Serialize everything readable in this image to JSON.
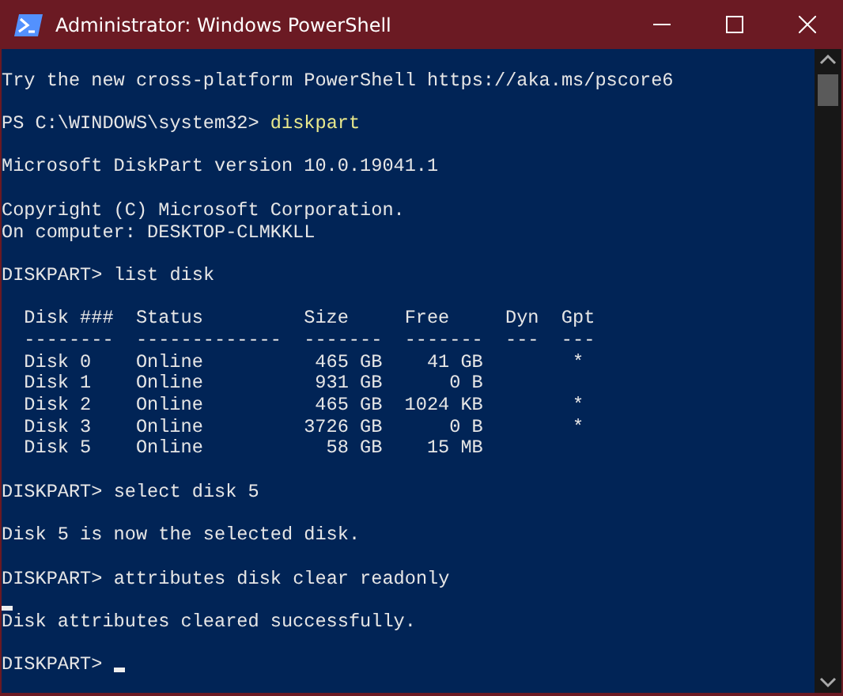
{
  "window": {
    "title": "Administrator: Windows PowerShell"
  },
  "lines": [
    {
      "kind": "blank"
    },
    {
      "kind": "text",
      "text": "Try the new cross-platform PowerShell https://aka.ms/pscore6"
    },
    {
      "kind": "blank"
    },
    {
      "kind": "prompt",
      "prompt": "PS C:\\WINDOWS\\system32>",
      "command": "diskpart",
      "highlight": true
    },
    {
      "kind": "blank"
    },
    {
      "kind": "text",
      "text": "Microsoft DiskPart version 10.0.19041.1"
    },
    {
      "kind": "blank"
    },
    {
      "kind": "text",
      "text": "Copyright (C) Microsoft Corporation."
    },
    {
      "kind": "text",
      "text": "On computer: DESKTOP-CLMKKLL"
    },
    {
      "kind": "blank"
    },
    {
      "kind": "prompt",
      "prompt": "DISKPART>",
      "command": "list disk",
      "highlight": false
    },
    {
      "kind": "blank"
    },
    {
      "kind": "table"
    },
    {
      "kind": "blank"
    },
    {
      "kind": "prompt",
      "prompt": "DISKPART>",
      "command": "select disk 5",
      "highlight": false
    },
    {
      "kind": "blank"
    },
    {
      "kind": "text",
      "text": "Disk 5 is now the selected disk."
    },
    {
      "kind": "blank"
    },
    {
      "kind": "prompt",
      "prompt": "DISKPART>",
      "command": "attributes disk clear readonly",
      "highlight": false
    },
    {
      "kind": "cursor"
    },
    {
      "kind": "text",
      "text": "Disk attributes cleared successfully."
    },
    {
      "kind": "blank"
    },
    {
      "kind": "prompt",
      "prompt": "DISKPART>",
      "cursor": true
    }
  ],
  "table": {
    "columns": [
      {
        "heading": "Disk ###",
        "rule": "--------"
      },
      {
        "heading": "Status",
        "rule": "-------------"
      },
      {
        "heading": "Size",
        "rule": "-------"
      },
      {
        "heading": "Free",
        "rule": "-------"
      },
      {
        "heading": "Dyn",
        "rule": "---"
      },
      {
        "heading": "Gpt",
        "rule": "---"
      }
    ],
    "rows": [
      {
        "disk": "Disk 0",
        "status": "Online",
        "size": "465 GB",
        "free": "41 GB",
        "gpt": "*"
      },
      {
        "disk": "Disk 1",
        "status": "Online",
        "size": "931 GB",
        "free": "0 B"
      },
      {
        "disk": "Disk 2",
        "status": "Online",
        "size": "465 GB",
        "free": "1024 KB",
        "gpt": "*"
      },
      {
        "disk": "Disk 3",
        "status": "Online",
        "size": "3726 GB",
        "free": "0 B",
        "gpt": "*"
      },
      {
        "disk": "Disk 5",
        "status": "Online",
        "size": "58 GB",
        "free": "15 MB"
      }
    ]
  }
}
